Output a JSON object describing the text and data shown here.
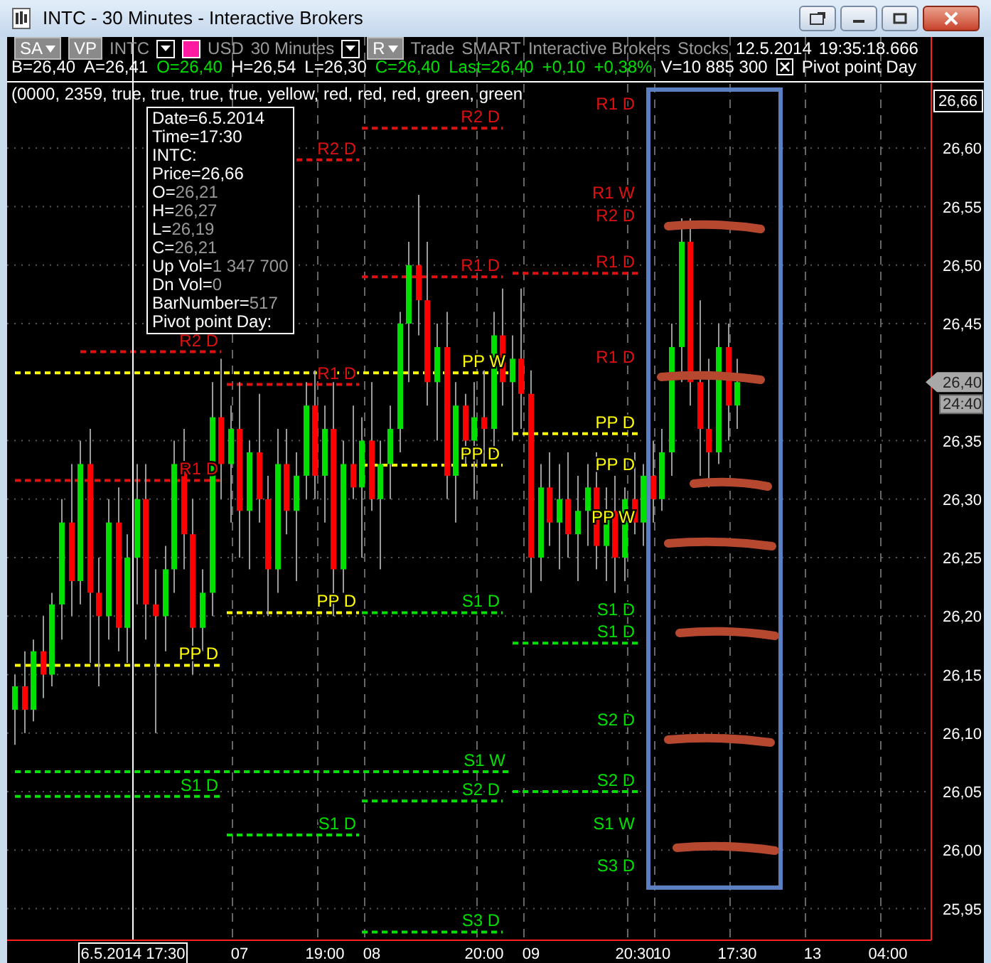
{
  "window": {
    "title": "INTC - 30 Minutes - Interactive Brokers"
  },
  "toolbar": [
    {
      "kind": "button",
      "label": "SA",
      "dropdown": true
    },
    {
      "kind": "button",
      "label": "VP",
      "dropdown": false
    },
    {
      "kind": "text",
      "label": "INTC",
      "muted": true
    },
    {
      "kind": "dropdown"
    },
    {
      "kind": "color-picker"
    },
    {
      "kind": "text",
      "label": "USD",
      "muted": true
    },
    {
      "kind": "text",
      "label": "30 Minutes",
      "muted": true
    },
    {
      "kind": "dropdown"
    },
    {
      "kind": "button",
      "label": "R",
      "dropdown": true
    },
    {
      "kind": "text",
      "label": "Trade",
      "muted": true
    },
    {
      "kind": "text",
      "label": "SMART",
      "muted": true
    },
    {
      "kind": "text",
      "label": "Interactive Brokers",
      "muted": true
    },
    {
      "kind": "text",
      "label": "Stocks",
      "muted": true
    },
    {
      "kind": "text",
      "label": "12.5.2014",
      "muted": false
    },
    {
      "kind": "text",
      "label": "19:35:18.666",
      "muted": false
    }
  ],
  "quote": [
    {
      "text": "B=26,40",
      "color": "#ffffff"
    },
    {
      "text": "A=26,41",
      "color": "#ffffff"
    },
    {
      "text": "O=26,40",
      "color": "#00e000"
    },
    {
      "text": "H=26,54",
      "color": "#ffffff"
    },
    {
      "text": "L=26,30",
      "color": "#ffffff"
    },
    {
      "text": "C=26,40",
      "color": "#00e000"
    },
    {
      "text": "Last=26,40",
      "color": "#00e000"
    },
    {
      "text": "+0,10",
      "color": "#00e000"
    },
    {
      "text": "+0,38%",
      "color": "#00e000"
    },
    {
      "text": "V=10 885 300",
      "color": "#ffffff"
    }
  ],
  "indicator": {
    "label": "Pivot point Day"
  },
  "study_params": "(0000, 2359, true, true, true, true, yellow, red, red, red, green, green",
  "tooltip": [
    {
      "label": "Date=6.5.2014"
    },
    {
      "label": "Time=17:30"
    },
    {
      "label": "INTC:"
    },
    {
      "label": "Price=26,66"
    },
    {
      "label": "O=",
      "value": "26,21"
    },
    {
      "label": "H=",
      "value": "26,27"
    },
    {
      "label": "L=",
      "value": "26,19"
    },
    {
      "label": "C=",
      "value": "26,21"
    },
    {
      "label": "Up Vol=",
      "value": "1 347 700"
    },
    {
      "label": "Dn Vol=",
      "value": "0"
    },
    {
      "label": "BarNumber=",
      "value": "517"
    },
    {
      "label": "Pivot point Day:"
    }
  ],
  "chart": {
    "crosshair": {
      "price_label": "26,66",
      "time_label": "6.5.2014 17:30"
    },
    "last_price": "26,40",
    "countdown": "24:40",
    "chart_data": {
      "type": "candlestick",
      "ylim": [
        25.923,
        26.695
      ],
      "categories": [
        null,
        null,
        null,
        null,
        null,
        null,
        null,
        null,
        null,
        null,
        null,
        null,
        null,
        null,
        null,
        null,
        null,
        null,
        null,
        null,
        null,
        null,
        null,
        null,
        "07",
        null,
        null,
        null,
        null,
        null,
        null,
        null,
        null,
        "19:00",
        null,
        null,
        null,
        null,
        "08",
        null,
        null,
        null,
        null,
        null,
        null,
        null,
        null,
        null,
        null,
        null,
        "20:00",
        null,
        null,
        null,
        null,
        "09",
        null,
        null,
        null,
        null,
        null,
        null,
        null,
        null,
        null,
        null,
        "20:30",
        null,
        null,
        "10",
        null,
        null,
        null,
        null,
        null,
        null,
        null,
        "17:30",
        null,
        null,
        null,
        null,
        null,
        null,
        null,
        "13",
        null,
        null,
        null,
        null,
        null,
        null,
        null,
        "04:00",
        null,
        null
      ],
      "ohlc": [
        [
          26.12,
          26.15,
          26.09,
          26.14
        ],
        [
          26.14,
          26.17,
          26.1,
          26.12
        ],
        [
          26.12,
          26.18,
          26.11,
          26.17
        ],
        [
          26.17,
          26.2,
          26.13,
          26.15
        ],
        [
          26.15,
          26.22,
          26.14,
          26.21
        ],
        [
          26.21,
          26.3,
          26.18,
          26.28
        ],
        [
          26.28,
          26.33,
          26.2,
          26.23
        ],
        [
          26.23,
          26.35,
          26.21,
          26.33
        ],
        [
          26.33,
          26.36,
          26.16,
          26.22
        ],
        [
          26.22,
          26.25,
          26.14,
          26.2
        ],
        [
          26.2,
          26.3,
          26.18,
          26.28
        ],
        [
          26.28,
          26.31,
          26.17,
          26.19
        ],
        [
          26.19,
          26.27,
          26.16,
          26.25
        ],
        [
          26.25,
          26.33,
          26.21,
          26.3
        ],
        [
          26.3,
          26.33,
          26.18,
          26.21
        ],
        [
          26.21,
          26.24,
          26.1,
          26.2
        ],
        [
          26.2,
          26.26,
          26.17,
          26.24
        ],
        [
          26.24,
          26.35,
          26.22,
          26.33
        ],
        [
          26.33,
          26.36,
          26.24,
          26.27
        ],
        [
          26.27,
          26.3,
          26.15,
          26.19
        ],
        [
          26.19,
          26.24,
          26.17,
          26.22
        ],
        [
          26.22,
          26.4,
          26.2,
          26.37
        ],
        [
          26.37,
          26.42,
          26.3,
          26.33
        ],
        [
          26.33,
          26.38,
          26.28,
          26.36
        ],
        [
          26.36,
          26.4,
          26.25,
          26.29
        ],
        [
          26.29,
          26.35,
          26.24,
          26.34
        ],
        [
          26.34,
          26.39,
          26.28,
          26.3
        ],
        [
          26.3,
          26.32,
          26.2,
          26.24
        ],
        [
          26.24,
          26.36,
          26.22,
          26.33
        ],
        [
          26.33,
          26.36,
          26.27,
          26.29
        ],
        [
          26.29,
          26.34,
          26.23,
          26.32
        ],
        [
          26.32,
          26.4,
          26.3,
          26.38
        ],
        [
          26.38,
          26.41,
          26.3,
          26.32
        ],
        [
          26.32,
          26.38,
          26.28,
          26.36
        ],
        [
          26.36,
          26.4,
          26.2,
          26.24
        ],
        [
          26.24,
          26.35,
          26.22,
          26.33
        ],
        [
          26.33,
          26.38,
          26.3,
          26.31
        ],
        [
          26.31,
          26.37,
          26.25,
          26.35
        ],
        [
          26.35,
          26.4,
          26.29,
          26.3
        ],
        [
          26.3,
          26.35,
          26.24,
          26.33
        ],
        [
          26.33,
          26.38,
          26.3,
          26.36
        ],
        [
          26.36,
          26.46,
          26.34,
          26.45
        ],
        [
          26.45,
          26.52,
          26.4,
          26.5
        ],
        [
          26.5,
          26.56,
          26.44,
          26.47
        ],
        [
          26.47,
          26.52,
          26.38,
          26.4
        ],
        [
          26.4,
          26.45,
          26.35,
          26.43
        ],
        [
          26.43,
          26.46,
          26.3,
          26.32
        ],
        [
          26.32,
          26.4,
          26.28,
          26.38
        ],
        [
          26.38,
          26.39,
          26.33,
          26.35
        ],
        [
          26.35,
          26.4,
          26.3,
          26.37
        ],
        [
          26.37,
          26.41,
          26.33,
          26.36
        ],
        [
          26.36,
          26.46,
          26.34,
          26.44
        ],
        [
          26.44,
          26.48,
          26.38,
          26.4
        ],
        [
          26.4,
          26.44,
          26.35,
          26.42
        ],
        [
          26.42,
          26.48,
          26.36,
          26.39
        ],
        [
          26.39,
          26.41,
          26.22,
          26.25
        ],
        [
          26.25,
          26.33,
          26.23,
          26.31
        ],
        [
          26.31,
          26.34,
          26.26,
          26.28
        ],
        [
          26.28,
          26.33,
          26.24,
          26.3
        ],
        [
          26.3,
          26.34,
          26.25,
          26.27
        ],
        [
          26.27,
          26.32,
          26.23,
          26.29
        ],
        [
          26.29,
          26.33,
          26.26,
          26.31
        ],
        [
          26.31,
          26.34,
          26.24,
          26.26
        ],
        [
          26.26,
          26.31,
          26.23,
          26.29
        ],
        [
          26.29,
          26.32,
          26.22,
          26.25
        ],
        [
          26.25,
          26.31,
          26.23,
          26.3
        ],
        [
          26.3,
          26.34,
          26.27,
          26.28
        ],
        [
          26.28,
          26.33,
          26.26,
          26.32
        ],
        [
          26.32,
          26.35,
          26.28,
          26.3
        ],
        [
          26.3,
          26.36,
          26.29,
          26.34
        ],
        [
          26.34,
          26.45,
          26.32,
          26.43
        ],
        [
          26.43,
          26.54,
          26.4,
          26.52
        ],
        [
          26.52,
          26.54,
          26.38,
          26.4
        ],
        [
          26.4,
          26.47,
          26.32,
          26.36
        ],
        [
          26.36,
          26.42,
          26.31,
          26.34
        ],
        [
          26.34,
          26.45,
          26.33,
          26.43
        ],
        [
          26.43,
          26.45,
          26.35,
          26.38
        ],
        [
          26.38,
          26.42,
          26.36,
          26.4
        ],
        null,
        null,
        null,
        null,
        null,
        null,
        null,
        null,
        null,
        null,
        null,
        null,
        null,
        null,
        null,
        null,
        null,
        null
      ],
      "yticks": [
        {
          "value": 25.95,
          "label": "25,95"
        },
        {
          "value": 26.0,
          "label": "26,00"
        },
        {
          "value": 26.05,
          "label": "26,05"
        },
        {
          "value": 26.1,
          "label": "26,10"
        },
        {
          "value": 26.15,
          "label": "26,15"
        },
        {
          "value": 26.2,
          "label": "26,20"
        },
        {
          "value": 26.25,
          "label": "26,25"
        },
        {
          "value": 26.3,
          "label": "26,30"
        },
        {
          "value": 26.35,
          "label": "26,35"
        },
        {
          "value": 26.45,
          "label": "26,45"
        },
        {
          "value": 26.5,
          "label": "26,50"
        },
        {
          "value": 26.55,
          "label": "26,55"
        },
        {
          "value": 26.6,
          "label": "26,60"
        }
      ],
      "grid": true
    },
    "pivot_lines": [
      {
        "label": "R2 D",
        "color": "#e01010"
      },
      {
        "label": "R1 D",
        "color": "#e01010"
      },
      {
        "label": "PP D",
        "color": "#ffff00"
      },
      {
        "label": "S1 D",
        "color": "#00e000"
      },
      {
        "label": "R2 D",
        "color": "#e01010"
      },
      {
        "label": "R1 D",
        "color": "#e01010"
      },
      {
        "label": "PP D",
        "color": "#ffff00"
      },
      {
        "label": "S1 D",
        "color": "#00e000"
      },
      {
        "label": "R2 D",
        "color": "#e01010"
      },
      {
        "label": "R1 D",
        "color": "#e01010"
      },
      {
        "label": "PP W",
        "color": "#ffff00"
      },
      {
        "label": "PP D",
        "color": "#ffff00"
      },
      {
        "label": "S1 D",
        "color": "#00e000"
      },
      {
        "label": "S1 W",
        "color": "#00e000"
      },
      {
        "label": "S2 D",
        "color": "#00e000"
      },
      {
        "label": "S3 D",
        "color": "#00e000"
      },
      {
        "label": "R1 D",
        "color": "#e01010"
      },
      {
        "label": "R1 W",
        "color": "#e01010"
      },
      {
        "label": "R2 D",
        "color": "#e01010"
      },
      {
        "label": "R1 D",
        "color": "#e01010"
      },
      {
        "label": "R1 D",
        "color": "#e01010"
      },
      {
        "label": "PP D",
        "color": "#ffff00"
      },
      {
        "label": "PP D",
        "color": "#ffff00"
      },
      {
        "label": "PP W",
        "color": "#ffff00"
      },
      {
        "label": "S1 D",
        "color": "#00e000"
      },
      {
        "label": "S1 D",
        "color": "#00e000"
      },
      {
        "label": "S2 D",
        "color": "#00e000"
      },
      {
        "label": "S2 D",
        "color": "#00e000"
      },
      {
        "label": "S1 W",
        "color": "#00e000"
      },
      {
        "label": "S3 D",
        "color": "#00e000"
      }
    ]
  }
}
